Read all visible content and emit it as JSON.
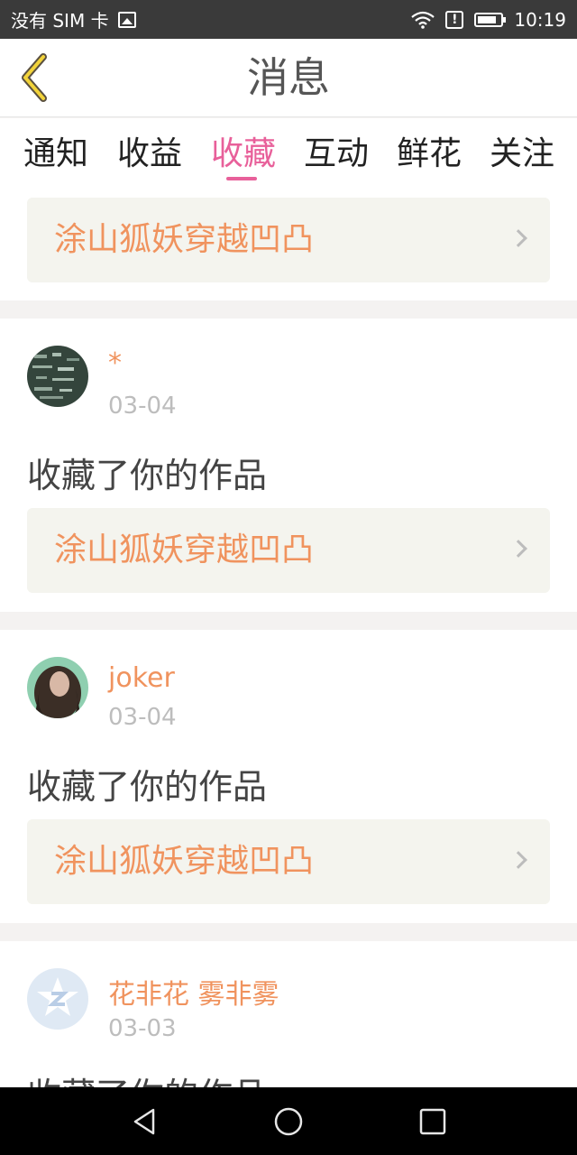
{
  "status_bar": {
    "carrier": "没有 SIM 卡",
    "time": "10:19",
    "battery_level": 0.85
  },
  "header": {
    "title": "消息",
    "back_icon": "chevron-left-icon"
  },
  "tabs": [
    {
      "label": "通知",
      "active": false
    },
    {
      "label": "收益",
      "active": false
    },
    {
      "label": "收藏",
      "active": true
    },
    {
      "label": "互动",
      "active": false
    },
    {
      "label": "鲜花",
      "active": false
    },
    {
      "label": "关注",
      "active": false
    }
  ],
  "messages": [
    {
      "work_title": "涂山狐妖穿越凹凸"
    },
    {
      "username": "*",
      "date": "03-04",
      "action": "收藏了你的作品",
      "work_title": "涂山狐妖穿越凹凸"
    },
    {
      "username": "joker",
      "date": "03-04",
      "action": "收藏了你的作品",
      "work_title": "涂山狐妖穿越凹凸"
    },
    {
      "username": "花非花 雾非雾",
      "date": "03-03",
      "action": "收藏了你的作品"
    }
  ],
  "colors": {
    "accent_pink": "#e8609a",
    "username_orange": "#f0935e",
    "card_link_bg": "#f4f4ee",
    "page_bg": "#f4f2f1"
  }
}
